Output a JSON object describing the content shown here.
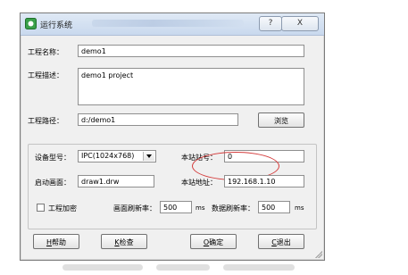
{
  "window": {
    "title": "运行系统",
    "help_button": "?",
    "close_button": "X"
  },
  "project": {
    "name_label": "工程名称：",
    "name_value": "demo1",
    "desc_label": "工程描述：",
    "desc_value": "demo1 project",
    "path_label": "工程路径：",
    "path_value": "d:/demo1",
    "browse_button": "浏览"
  },
  "device": {
    "model_label": "设备型号：",
    "model_value": "IPC(1024x768)",
    "station_no_label": "本站站号：",
    "station_no_value": "0",
    "start_screen_label": "启动画面：",
    "start_screen_value": "draw1.drw",
    "station_addr_label": "本站地址：",
    "station_addr_value": "192.168.1.10",
    "encrypt_label": "工程加密",
    "encrypt_checked": false,
    "screen_refresh_label": "画面刷新率：",
    "screen_refresh_value": "500",
    "screen_refresh_unit": "ms",
    "data_refresh_label": "数据刷新率：",
    "data_refresh_value": "500",
    "data_refresh_unit": "ms"
  },
  "buttons": {
    "help_hotkey": "H",
    "help": "帮助",
    "check_hotkey": "K",
    "check": "检查",
    "ok_hotkey": "O",
    "ok": "确定",
    "exit_hotkey": "C",
    "exit": "退出"
  },
  "colors": {
    "highlight": "#d43b3b",
    "titlebar": "#c9d9ee"
  }
}
